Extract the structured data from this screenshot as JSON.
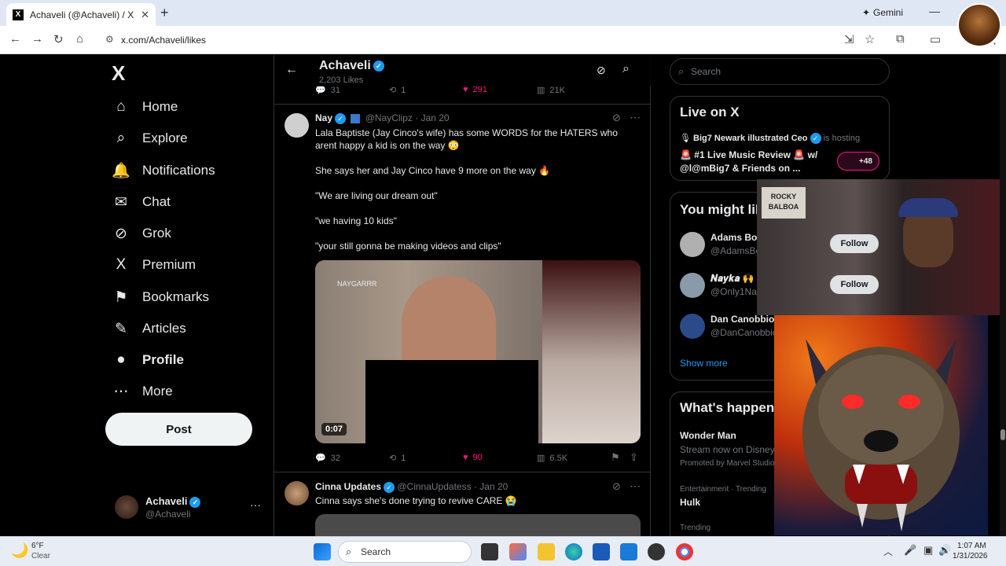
{
  "browser": {
    "tab_title": "Achaveli (@Achaveli) / X",
    "tab_close": "✕",
    "new_tab": "+",
    "gemini_label": "Gemini",
    "url": "x.com/Achaveli/likes",
    "minimize": "—",
    "maximize": "☐",
    "close": "✕"
  },
  "nav": {
    "logo": "X",
    "items": [
      {
        "label": "Home",
        "icon": "home-icon",
        "glyph": "⌂"
      },
      {
        "label": "Explore",
        "icon": "search-icon",
        "glyph": "⌕"
      },
      {
        "label": "Notifications",
        "icon": "bell-icon",
        "glyph": "🔔"
      },
      {
        "label": "Chat",
        "icon": "envelope-icon",
        "glyph": "✉"
      },
      {
        "label": "Grok",
        "icon": "grok-icon",
        "glyph": "⊘"
      },
      {
        "label": "Premium",
        "icon": "x-premium-icon",
        "glyph": "X"
      },
      {
        "label": "Bookmarks",
        "icon": "bookmark-icon",
        "glyph": "⚑"
      },
      {
        "label": "Articles",
        "icon": "articles-icon",
        "glyph": "✎"
      },
      {
        "label": "Profile",
        "icon": "profile-icon",
        "glyph": "●"
      },
      {
        "label": "More",
        "icon": "more-icon",
        "glyph": "⋯"
      }
    ],
    "post_button": "Post",
    "account": {
      "name": "Achaveli",
      "handle": "@Achaveli"
    },
    "account_more": "···"
  },
  "feed": {
    "header": {
      "name": "Achaveli",
      "likes_count": "2,203 Likes"
    },
    "prev_post_actions": {
      "replies": "31",
      "reposts": "1",
      "likes": "291",
      "views": "21K"
    },
    "post1": {
      "author": "Nay",
      "handle": "@NayClipz",
      "date": "· Jan 20",
      "text_lines": [
        "Lala Baptiste (Jay Cinco's wife) has some WORDS for the HATERS who",
        "arent happy a kid is on the way 😳",
        "She says her and Jay Cinco have 9 more on the way 🔥",
        "\"We are living our dream out\"",
        "\"we having 10 kids\"",
        "\"your still gonna be making videos and clips\""
      ],
      "video_watermark": "NAYGARRR",
      "video_duration": "0:07",
      "replies": "32",
      "reposts": "1",
      "likes": "90",
      "views": "6.5K"
    },
    "post2": {
      "author": "Cinna Updates",
      "handle": "@CinnaUpdatess",
      "date": "· Jan 20",
      "text": "Cinna says she's done trying to revive CARE 😭"
    }
  },
  "right": {
    "search_placeholder": "Search",
    "live": {
      "title": "Live on X",
      "host": "Big7 Newark illustrated Ceo",
      "hosting": "is hosting",
      "show_line1": "🚨 #1 Live Music Review 🚨 w/",
      "show_line2": "@l@mBig7 & Friends on ...",
      "listeners": "+48"
    },
    "might_like": {
      "title": "You might like",
      "users": [
        {
          "name": "Adams Boxing Show",
          "handle": "@AdamsBoxingShow",
          "button": "Follow"
        },
        {
          "name": "𝑵𝒂𝒚𝒌𝒂 🙌",
          "handle": "@Only1Nayka",
          "button": "Follow"
        },
        {
          "name": "Dan Canobbio",
          "handle": "@DanCanobbio",
          "button": ""
        }
      ],
      "show_more": "Show more"
    },
    "happening": {
      "title": "What's happening",
      "promo_title": "Wonder Man",
      "promo_sub": "Stream now on Disney+",
      "promo_by": "Promoted by Marvel Studios",
      "trend_cat": "Entertainment · Trending",
      "trend_name": "Hulk",
      "trend_cat2": "Trending"
    }
  },
  "overlay": {
    "webcam_sign": "ROCKY BALBOA"
  },
  "taskbar": {
    "weather_temp": "6°F",
    "weather_desc": "Clear",
    "search": "Search",
    "time": "1:07 AM",
    "date": "1/31/2026"
  }
}
